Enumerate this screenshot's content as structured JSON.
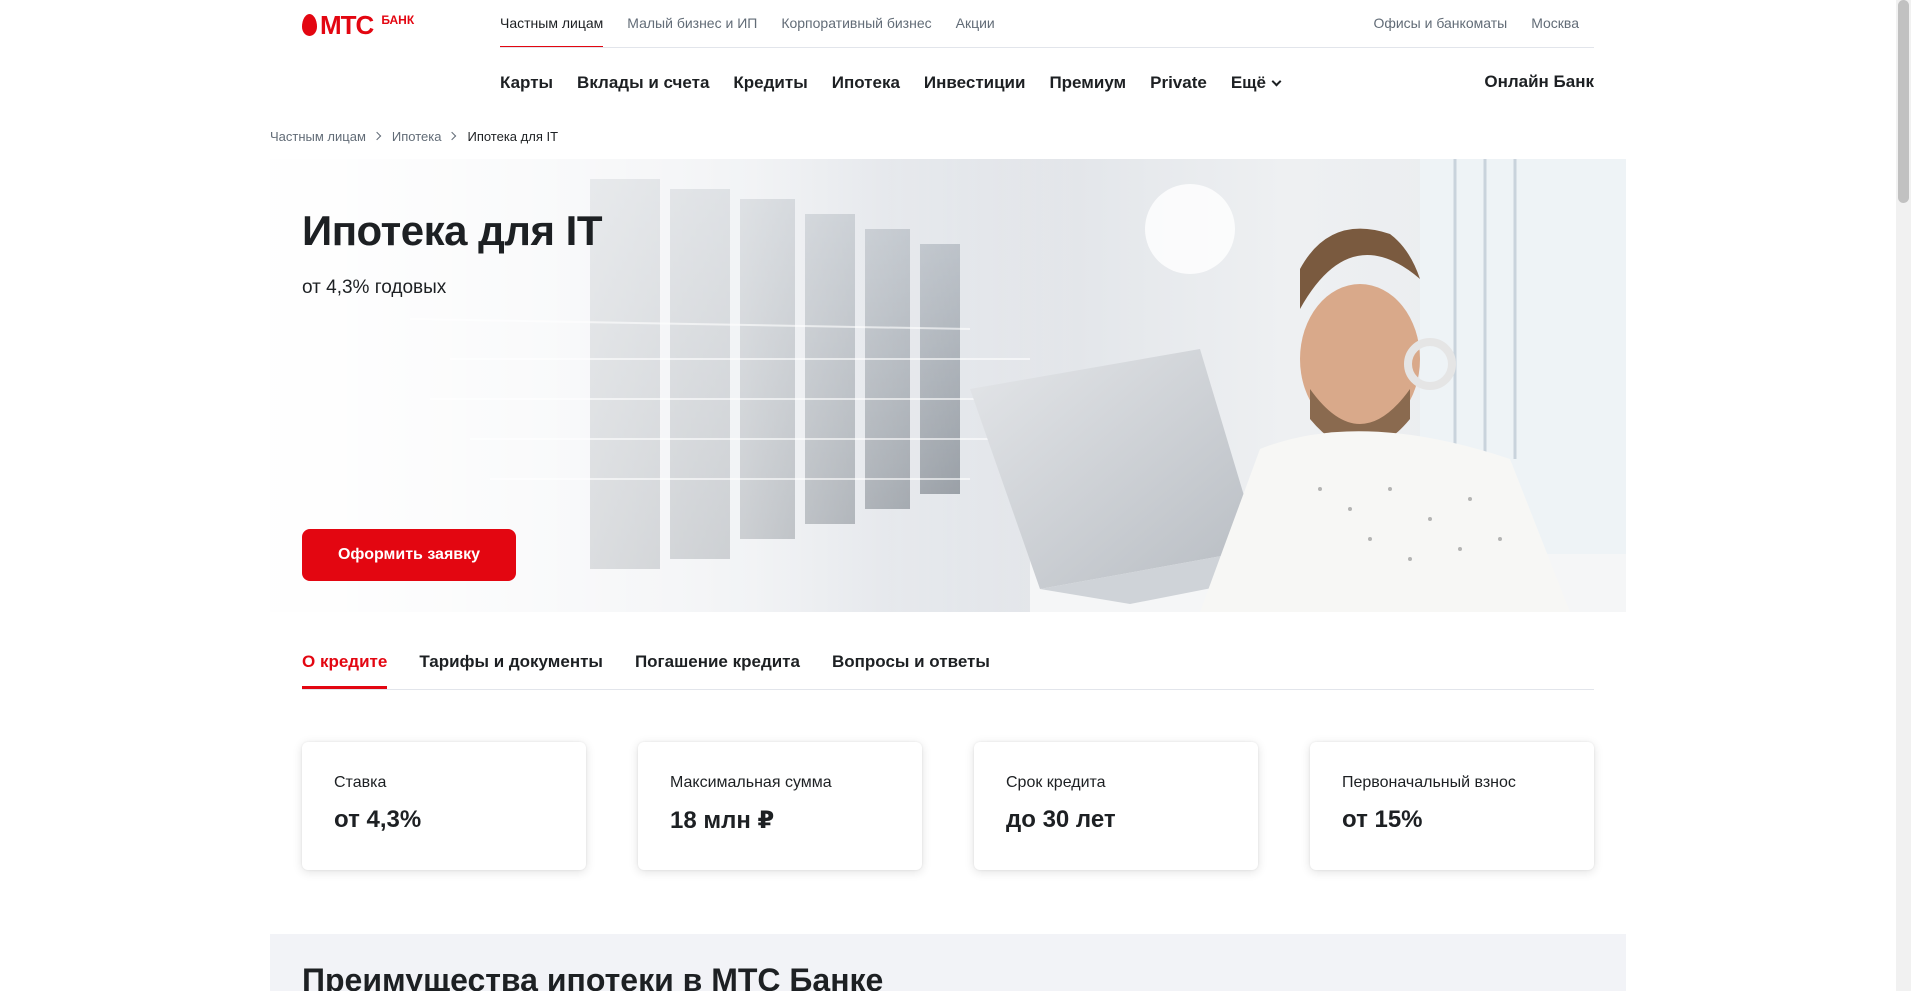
{
  "logo": {
    "brand": "МТС",
    "suffix": "БАНК",
    "icon": "mts-egg-icon"
  },
  "segments": [
    {
      "label": "Частным лицам",
      "active": true
    },
    {
      "label": "Малый бизнес и ИП",
      "active": false
    },
    {
      "label": "Корпоративный бизнес",
      "active": false
    },
    {
      "label": "Акции",
      "active": false
    }
  ],
  "top_right": {
    "offices": "Офисы и банкоматы",
    "city": "Москва"
  },
  "main_nav": {
    "items": [
      "Карты",
      "Вклады и счета",
      "Кредиты",
      "Ипотека",
      "Инвестиции",
      "Премиум",
      "Private"
    ],
    "more": "Ещё",
    "online_bank": "Онлайн Банк"
  },
  "breadcrumb": [
    "Частным лицам",
    "Ипотека",
    "Ипотека для IT"
  ],
  "hero": {
    "title": "Ипотека для IT",
    "subtitle": "от 4,3% годовых",
    "cta": "Оформить заявку"
  },
  "tabs": [
    {
      "label": "О кредите",
      "active": true
    },
    {
      "label": "Тарифы и документы",
      "active": false
    },
    {
      "label": "Погашение кредита",
      "active": false
    },
    {
      "label": "Вопросы и ответы",
      "active": false
    }
  ],
  "cards": [
    {
      "label": "Ставка",
      "value": "от 4,3%"
    },
    {
      "label": "Максимальная сумма",
      "value": "18 млн ₽"
    },
    {
      "label": "Срок кредита",
      "value": "до 30 лет"
    },
    {
      "label": "Первоначальный взнос",
      "value": "от 15%"
    }
  ],
  "advantages": {
    "title": "Преимущества ипотеки в МТС Банке"
  },
  "colors": {
    "brand_red": "#e30611",
    "text": "#1d2023",
    "muted": "#626c77",
    "divider": "#e2e5eb"
  }
}
